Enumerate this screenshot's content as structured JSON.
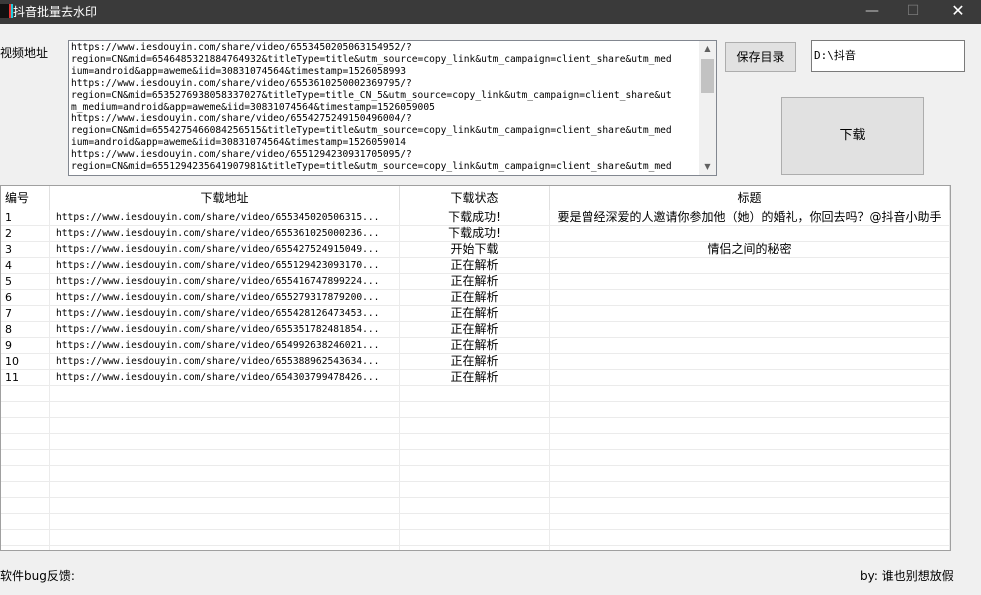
{
  "window": {
    "title": "抖音批量去水印",
    "minimize": "—",
    "maximize": "☐",
    "close": "✕"
  },
  "form": {
    "url_label": "视频地址",
    "url_text": "https://www.iesdouyin.com/share/video/6553450205063154952/?\nregion=CN&mid=6546485321884764932&titleType=title&utm_source=copy_link&utm_campaign=client_share&utm_med\nium=android&app=aweme&iid=30831074564&timestamp=1526058993\nhttps://www.iesdouyin.com/share/video/6553610250002369795/?\nregion=CN&mid=6535276938058337027&titleType=title_CN_5&utm_source=copy_link&utm_campaign=client_share&ut\nm_medium=android&app=aweme&iid=30831074564&timestamp=1526059005\nhttps://www.iesdouyin.com/share/video/6554275249150496004/?\nregion=CN&mid=6554275466084256515&titleType=title&utm_source=copy_link&utm_campaign=client_share&utm_med\nium=android&app=aweme&iid=30831074564&timestamp=1526059014\nhttps://www.iesdouyin.com/share/video/6551294230931705095/?\nregion=CN&mid=6551294235641907981&titleType=title&utm_source=copy_link&utm_campaign=client_share&utm_med",
    "save_button": "保存目录",
    "save_dir": "D:\\抖音",
    "download_button": "下载"
  },
  "table": {
    "columns": [
      "编号",
      "下载地址",
      "下载状态",
      "标题"
    ],
    "rows": [
      {
        "id": "1",
        "url": "https://www.iesdouyin.com/share/video/655345020506315...",
        "status": "下载成功!",
        "title": "要是曾经深爱的人邀请你参加他（她）的婚礼，你回去吗？@抖音小助手"
      },
      {
        "id": "2",
        "url": "https://www.iesdouyin.com/share/video/655361025000236...",
        "status": "下载成功!",
        "title": ""
      },
      {
        "id": "3",
        "url": "https://www.iesdouyin.com/share/video/655427524915049...",
        "status": "开始下载",
        "title": "情侣之间的秘密"
      },
      {
        "id": "4",
        "url": "https://www.iesdouyin.com/share/video/655129423093170...",
        "status": "正在解析",
        "title": ""
      },
      {
        "id": "5",
        "url": "https://www.iesdouyin.com/share/video/655416747899224...",
        "status": "正在解析",
        "title": ""
      },
      {
        "id": "6",
        "url": "https://www.iesdouyin.com/share/video/655279317879200...",
        "status": "正在解析",
        "title": ""
      },
      {
        "id": "7",
        "url": "https://www.iesdouyin.com/share/video/655428126473453...",
        "status": "正在解析",
        "title": ""
      },
      {
        "id": "8",
        "url": "https://www.iesdouyin.com/share/video/655351782481854...",
        "status": "正在解析",
        "title": ""
      },
      {
        "id": "9",
        "url": "https://www.iesdouyin.com/share/video/654992638246021...",
        "status": "正在解析",
        "title": ""
      },
      {
        "id": "10",
        "url": "https://www.iesdouyin.com/share/video/655388962543634...",
        "status": "正在解析",
        "title": ""
      },
      {
        "id": "11",
        "url": "https://www.iesdouyin.com/share/video/654303799478426...",
        "status": "正在解析",
        "title": ""
      },
      {
        "id": "",
        "url": "",
        "status": "",
        "title": ""
      },
      {
        "id": "",
        "url": "",
        "status": "",
        "title": ""
      },
      {
        "id": "",
        "url": "",
        "status": "",
        "title": ""
      },
      {
        "id": "",
        "url": "",
        "status": "",
        "title": ""
      },
      {
        "id": "",
        "url": "",
        "status": "",
        "title": ""
      },
      {
        "id": "",
        "url": "",
        "status": "",
        "title": ""
      },
      {
        "id": "",
        "url": "",
        "status": "",
        "title": ""
      },
      {
        "id": "",
        "url": "",
        "status": "",
        "title": ""
      },
      {
        "id": "",
        "url": "",
        "status": "",
        "title": ""
      },
      {
        "id": "",
        "url": "",
        "status": "",
        "title": ""
      },
      {
        "id": "",
        "url": "",
        "status": "",
        "title": ""
      }
    ]
  },
  "footer": {
    "feedback": "软件bug反馈:",
    "author": "by: 谁也别想放假"
  }
}
